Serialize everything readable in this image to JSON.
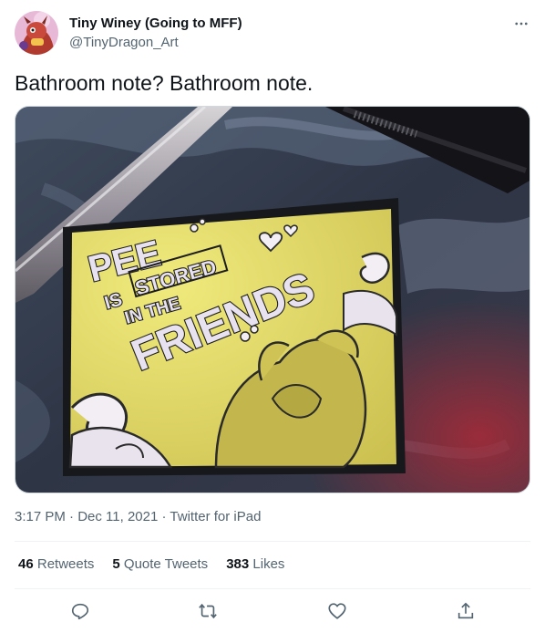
{
  "author": {
    "display_name": "Tiny Winey (Going to MFF)",
    "handle": "@TinyDragon_Art",
    "avatar_icon": "avatar"
  },
  "tweet": {
    "text": "Bathroom note? Bathroom note.",
    "photo_note_lettering": [
      "PEE",
      "IS",
      "STORED",
      "IN THE",
      "FRIENDS"
    ]
  },
  "meta": {
    "time": "3:17 PM",
    "date": "Dec 11, 2021",
    "source": "Twitter for iPad",
    "separator": "·"
  },
  "stats": {
    "retweets_count": "46",
    "retweets_label": "Retweets",
    "quotes_count": "5",
    "quotes_label": "Quote Tweets",
    "likes_count": "383",
    "likes_label": "Likes"
  },
  "icons": {
    "more": "more-icon",
    "reply": "reply-icon",
    "retweet": "retweet-icon",
    "like": "like-icon",
    "share": "share-icon"
  },
  "colors": {
    "text": "#0f1419",
    "secondary": "#536471",
    "divider": "#eff3f4",
    "note_yellow": "#e8e06a"
  }
}
